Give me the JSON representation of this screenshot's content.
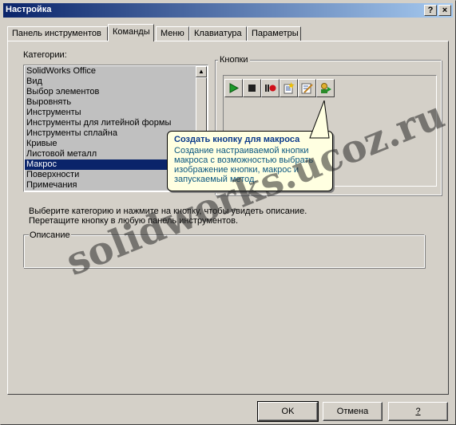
{
  "window": {
    "title": "Настройка",
    "help_glyph": "?",
    "close_glyph": "×"
  },
  "tabs": [
    {
      "label": "Панель инструментов",
      "active": false
    },
    {
      "label": "Команды",
      "active": true
    },
    {
      "label": "Меню",
      "active": false
    },
    {
      "label": "Клавиатура",
      "active": false
    },
    {
      "label": "Параметры",
      "active": false
    }
  ],
  "categories": {
    "label": "Категории:",
    "items": [
      "SolidWorks Office",
      "Вид",
      "Выбор элементов",
      "Выровнять",
      "Инструменты",
      "Инструменты для литейной формы",
      "Инструменты сплайна",
      "Кривые",
      "Листовой металл",
      "Макрос",
      "Поверхности",
      "Примечания"
    ],
    "selected": "Макрос",
    "scroll_up_glyph": "▲",
    "scroll_down_glyph": "▼"
  },
  "buttons_group": {
    "label": "Кнопки",
    "icons": [
      "run-macro-icon",
      "stop-macro-icon",
      "record-macro-icon",
      "new-macro-icon",
      "edit-macro-icon",
      "custom-macro-button-icon"
    ]
  },
  "tooltip": {
    "title": "Создать кнопку для макроса",
    "body": "Создание настраиваемой кнопки макроса с возможностью выбрать изображение кнопки, макрос и запускаемый метод."
  },
  "hint": {
    "line1": "Выберите категорию и нажмите на кнопку, чтобы увидеть описание.",
    "line2": "Перетащите кнопку в любую панель инструментов."
  },
  "description": {
    "label": "Описание",
    "value": ""
  },
  "watermark": "solidworks.ucoz.ru",
  "footer": {
    "ok": "OK",
    "cancel": "Отмена",
    "help": "?"
  }
}
